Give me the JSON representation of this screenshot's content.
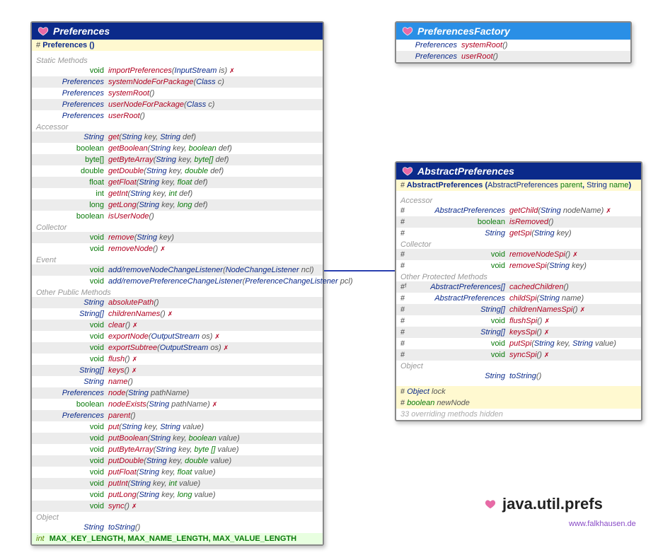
{
  "package": "java.util.prefs",
  "footer": "www.falkhausen.de",
  "preferences": {
    "title": "Preferences",
    "constructor": {
      "hash": "#",
      "name": "Preferences",
      "params": []
    },
    "sections": [
      {
        "label": "Static Methods",
        "methods": [
          {
            "ret": "void",
            "retkw": true,
            "name": "importPreferences",
            "params": [
              {
                "type": "InputStream",
                "name": "is"
              }
            ],
            "throws": true,
            "nameBlue": false
          },
          {
            "ret": "Preferences",
            "name": "systemNodeForPackage",
            "params": [
              {
                "type": "Class <?>",
                "name": "c"
              }
            ]
          },
          {
            "ret": "Preferences",
            "name": "systemRoot",
            "params": []
          },
          {
            "ret": "Preferences",
            "name": "userNodeForPackage",
            "params": [
              {
                "type": "Class<?>",
                "name": "c"
              }
            ]
          },
          {
            "ret": "Preferences",
            "name": "userRoot",
            "params": []
          }
        ]
      },
      {
        "label": "Accessor",
        "methods": [
          {
            "ret": "String",
            "name": "get",
            "params": [
              {
                "type": "String",
                "name": "key"
              },
              {
                "type": "String",
                "name": "def"
              }
            ]
          },
          {
            "ret": "boolean",
            "retkw": true,
            "name": "getBoolean",
            "params": [
              {
                "type": "String",
                "name": "key"
              },
              {
                "type": "boolean",
                "kw": true,
                "name": "def"
              }
            ]
          },
          {
            "ret": "byte[]",
            "retkw": true,
            "name": "getByteArray",
            "params": [
              {
                "type": "String",
                "name": "key"
              },
              {
                "type": "byte[]",
                "kw": true,
                "name": "def"
              }
            ]
          },
          {
            "ret": "double",
            "retkw": true,
            "name": "getDouble",
            "params": [
              {
                "type": "String",
                "name": "key"
              },
              {
                "type": "double",
                "kw": true,
                "name": "def"
              }
            ]
          },
          {
            "ret": "float",
            "retkw": true,
            "name": "getFloat",
            "params": [
              {
                "type": "String",
                "name": "key"
              },
              {
                "type": "float",
                "kw": true,
                "name": "def"
              }
            ]
          },
          {
            "ret": "int",
            "retkw": true,
            "name": "getInt",
            "params": [
              {
                "type": "String",
                "name": "key"
              },
              {
                "type": "int",
                "kw": true,
                "name": "def"
              }
            ]
          },
          {
            "ret": "long",
            "retkw": true,
            "name": "getLong",
            "params": [
              {
                "type": "String",
                "name": "key"
              },
              {
                "type": "long",
                "kw": true,
                "name": "def"
              }
            ]
          },
          {
            "ret": "boolean",
            "retkw": true,
            "name": "isUserNode",
            "params": []
          }
        ]
      },
      {
        "label": "Collector",
        "methods": [
          {
            "ret": "void",
            "retkw": true,
            "name": "remove",
            "params": [
              {
                "type": "String",
                "name": "key"
              }
            ]
          },
          {
            "ret": "void",
            "retkw": true,
            "name": "removeNode",
            "params": [],
            "throws": true
          }
        ]
      },
      {
        "label": "Event",
        "methods": [
          {
            "ret": "void",
            "retkw": true,
            "name": "add/removeNodeChangeListener",
            "nameBlue": true,
            "params": [
              {
                "type": "NodeChangeListener",
                "name": "ncl"
              }
            ]
          },
          {
            "ret": "void",
            "retkw": true,
            "name": "add/removePreferenceChangeListener",
            "nameBlue": true,
            "params": [
              {
                "type": "PreferenceChangeListener",
                "name": "pcl"
              }
            ]
          }
        ]
      },
      {
        "label": "Other Public Methods",
        "methods": [
          {
            "ret": "String",
            "name": "absolutePath",
            "params": []
          },
          {
            "ret": "String[]",
            "name": "childrenNames",
            "params": [],
            "throws": true
          },
          {
            "ret": "void",
            "retkw": true,
            "name": "clear",
            "params": [],
            "throws": true
          },
          {
            "ret": "void",
            "retkw": true,
            "name": "exportNode",
            "params": [
              {
                "type": "OutputStream",
                "name": "os"
              }
            ],
            "throws": true
          },
          {
            "ret": "void",
            "retkw": true,
            "name": "exportSubtree",
            "params": [
              {
                "type": "OutputStream",
                "name": "os"
              }
            ],
            "throws": true
          },
          {
            "ret": "void",
            "retkw": true,
            "name": "flush",
            "params": [],
            "throws": true
          },
          {
            "ret": "String[]",
            "name": "keys",
            "params": [],
            "throws": true
          },
          {
            "ret": "String",
            "name": "name",
            "params": []
          },
          {
            "ret": "Preferences",
            "name": "node",
            "params": [
              {
                "type": "String",
                "name": "pathName"
              }
            ]
          },
          {
            "ret": "boolean",
            "retkw": true,
            "name": "nodeExists",
            "params": [
              {
                "type": "String",
                "name": "pathName"
              }
            ],
            "throws": true
          },
          {
            "ret": "Preferences",
            "name": "parent",
            "params": []
          },
          {
            "ret": "void",
            "retkw": true,
            "name": "put",
            "params": [
              {
                "type": "String",
                "name": "key"
              },
              {
                "type": "String",
                "name": "value"
              }
            ]
          },
          {
            "ret": "void",
            "retkw": true,
            "name": "putBoolean",
            "params": [
              {
                "type": "String",
                "name": "key"
              },
              {
                "type": "boolean",
                "kw": true,
                "name": "value"
              }
            ]
          },
          {
            "ret": "void",
            "retkw": true,
            "name": "putByteArray",
            "params": [
              {
                "type": "String",
                "name": "key"
              },
              {
                "type": "byte []",
                "kw": true,
                "name": "value"
              }
            ]
          },
          {
            "ret": "void",
            "retkw": true,
            "name": "putDouble",
            "params": [
              {
                "type": "String",
                "name": "key"
              },
              {
                "type": "double",
                "kw": true,
                "name": "value"
              }
            ]
          },
          {
            "ret": "void",
            "retkw": true,
            "name": "putFloat",
            "params": [
              {
                "type": "String",
                "name": "key"
              },
              {
                "type": "float",
                "kw": true,
                "name": "value"
              }
            ]
          },
          {
            "ret": "void",
            "retkw": true,
            "name": "putInt",
            "params": [
              {
                "type": "String",
                "name": "key"
              },
              {
                "type": "int",
                "kw": true,
                "name": "value"
              }
            ]
          },
          {
            "ret": "void",
            "retkw": true,
            "name": "putLong",
            "params": [
              {
                "type": "String",
                "name": "key"
              },
              {
                "type": "long",
                "kw": true,
                "name": "value"
              }
            ]
          },
          {
            "ret": "void",
            "retkw": true,
            "name": "sync",
            "params": [],
            "throws": true
          }
        ]
      },
      {
        "label": "Object",
        "methods": [
          {
            "ret": "String",
            "name": "toString",
            "nameBlue": true,
            "params": []
          }
        ]
      }
    ],
    "constants": {
      "type": "int",
      "names": "MAX_KEY_LENGTH, MAX_NAME_LENGTH, MAX_VALUE_LENGTH"
    }
  },
  "prefsFactory": {
    "title": "PreferencesFactory",
    "methods": [
      {
        "ret": "Preferences",
        "name": "systemRoot",
        "params": []
      },
      {
        "ret": "Preferences",
        "name": "userRoot",
        "params": []
      }
    ]
  },
  "abstractPrefs": {
    "title": "AbstractPreferences",
    "constructor": {
      "hash": "#",
      "name": "AbstractPreferences",
      "params": [
        {
          "type": "AbstractPreferences",
          "name": "parent"
        },
        {
          "type": "String",
          "name": "name"
        }
      ]
    },
    "sections": [
      {
        "label": "Accessor",
        "methods": [
          {
            "vis": "#",
            "ret": "AbstractPreferences",
            "name": "getChild",
            "params": [
              {
                "type": "String",
                "name": "nodeName"
              }
            ],
            "throws": true
          },
          {
            "vis": "#",
            "ret": "boolean",
            "retkw": true,
            "name": "isRemoved",
            "params": []
          },
          {
            "vis": "#",
            "ret": "String",
            "name": "getSpi",
            "params": [
              {
                "type": "String",
                "name": "key"
              }
            ]
          }
        ]
      },
      {
        "label": "Collector",
        "methods": [
          {
            "vis": "#",
            "ret": "void",
            "retkw": true,
            "name": "removeNodeSpi",
            "params": [],
            "throws": true
          },
          {
            "vis": "#",
            "ret": "void",
            "retkw": true,
            "name": "removeSpi",
            "params": [
              {
                "type": "String",
                "name": "key"
              }
            ]
          }
        ]
      },
      {
        "label": "Other Protected Methods",
        "methods": [
          {
            "vis": "#ᶠ",
            "ret": "AbstractPreferences[]",
            "name": "cachedChildren",
            "params": []
          },
          {
            "vis": "#",
            "ret": "AbstractPreferences",
            "name": "childSpi",
            "params": [
              {
                "type": "String",
                "name": "name"
              }
            ]
          },
          {
            "vis": "#",
            "ret": "String[]",
            "name": "childrenNamesSpi",
            "params": [],
            "throws": true
          },
          {
            "vis": "#",
            "ret": "void",
            "retkw": true,
            "name": "flushSpi",
            "params": [],
            "throws": true
          },
          {
            "vis": "#",
            "ret": "String[]",
            "name": "keysSpi",
            "params": [],
            "throws": true
          },
          {
            "vis": "#",
            "ret": "void",
            "retkw": true,
            "name": "putSpi",
            "params": [
              {
                "type": "String",
                "name": "key"
              },
              {
                "type": "String",
                "name": "value"
              }
            ]
          },
          {
            "vis": "#",
            "ret": "void",
            "retkw": true,
            "name": "syncSpi",
            "params": [],
            "throws": true
          }
        ]
      },
      {
        "label": "Object",
        "methods": [
          {
            "ret": "String",
            "name": "toString",
            "nameBlue": true,
            "params": []
          }
        ]
      }
    ],
    "fields": [
      {
        "hash": "#",
        "type": "Object",
        "name": "lock"
      },
      {
        "hash": "#",
        "type": "boolean",
        "kw": true,
        "name": "newNode"
      }
    ],
    "note": "33 overriding methods hidden"
  }
}
